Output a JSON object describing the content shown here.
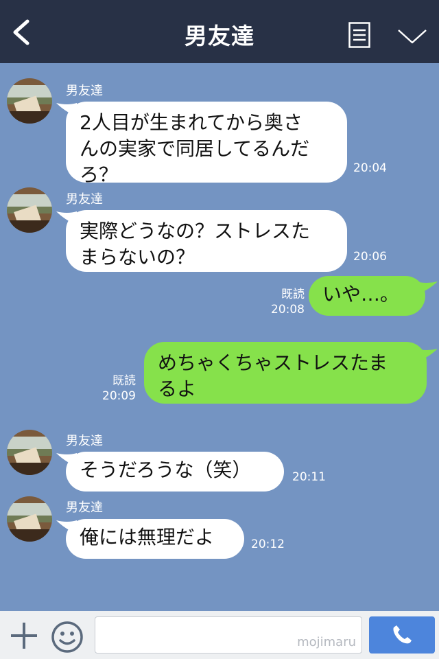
{
  "header": {
    "title": "男友達",
    "back_icon": "chevron-left-icon",
    "notes_icon": "notes-icon",
    "menu_icon": "chevron-down-icon"
  },
  "messages": [
    {
      "side": "left",
      "sender": "男友達",
      "lines": [
        "2人目が生まれてから奥さ",
        "んの実家で同居してるんだ",
        "ろ？"
      ],
      "time": "20:04"
    },
    {
      "side": "left",
      "sender": "男友達",
      "lines": [
        "実際どうなの？ストレスた",
        "まらないの？"
      ],
      "time": "20:06"
    },
    {
      "side": "right",
      "read": "既読",
      "lines": [
        "いや…。"
      ],
      "time": "20:08"
    },
    {
      "side": "right",
      "read": "既読",
      "lines": [
        "めちゃくちゃストレスたま",
        "るよ"
      ],
      "time": "20:09"
    },
    {
      "side": "left",
      "sender": "男友達",
      "lines": [
        "そうだろうな（笑）"
      ],
      "time": "20:11"
    },
    {
      "side": "left",
      "sender": "男友達",
      "lines": [
        "俺には無理だよ"
      ],
      "time": "20:12"
    }
  ],
  "footer": {
    "plus_icon": "plus-icon",
    "sticker_icon": "smile-icon",
    "input_placeholder": "",
    "watermark": "mojimaru",
    "call_icon": "phone-icon"
  },
  "colors": {
    "header": "#283146",
    "chat_bg": "#7494c2",
    "own_bubble": "#86e14b",
    "call_button": "#4d85dc"
  }
}
